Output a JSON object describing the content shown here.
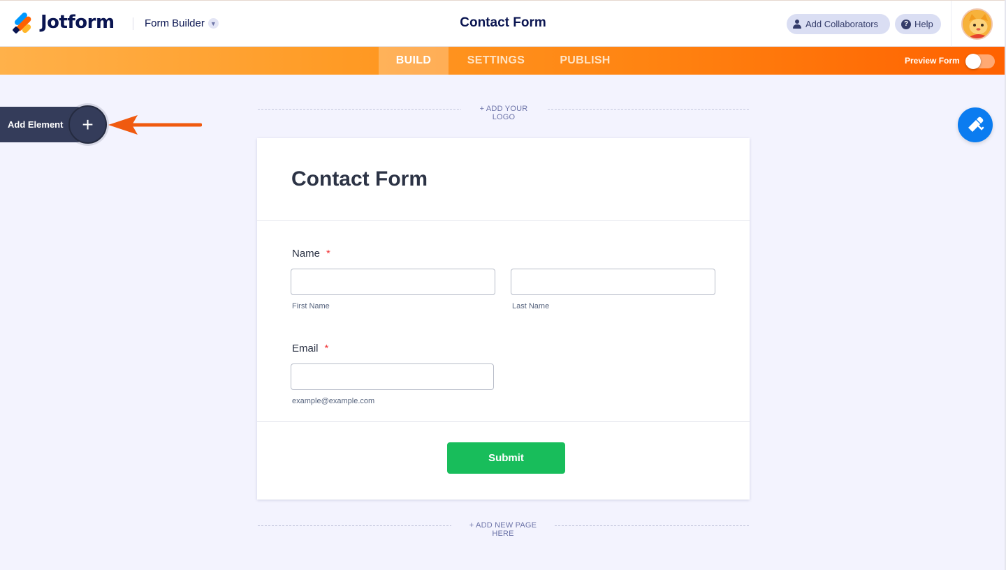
{
  "app": {
    "logo_text": "Jotform",
    "mode_label": "Form Builder",
    "form_title": "Contact Form",
    "add_collaborators_label": "Add Collaborators",
    "help_label": "Help"
  },
  "nav": {
    "tabs": [
      {
        "label": "BUILD",
        "active": true
      },
      {
        "label": "SETTINGS",
        "active": false
      },
      {
        "label": "PUBLISH",
        "active": false
      }
    ],
    "preview_label": "Preview Form",
    "preview_enabled": false
  },
  "sidebar": {
    "add_element_label": "Add Element",
    "add_icon": "plus-icon"
  },
  "canvas": {
    "add_logo_label": "+ ADD YOUR LOGO",
    "add_page_label": "+ ADD NEW PAGE HERE"
  },
  "form": {
    "heading": "Contact Form",
    "fields": {
      "name": {
        "label": "Name",
        "required_mark": "*",
        "first_sublabel": "First Name",
        "last_sublabel": "Last Name",
        "first_value": "",
        "last_value": ""
      },
      "email": {
        "label": "Email",
        "required_mark": "*",
        "sublabel": "example@example.com",
        "value": ""
      }
    },
    "submit_label": "Submit"
  },
  "colors": {
    "accent_orange": "#ff6100",
    "brand_navy": "#0a1551",
    "submit_green": "#18bd5b",
    "tool_blue": "#0b7cf0"
  }
}
